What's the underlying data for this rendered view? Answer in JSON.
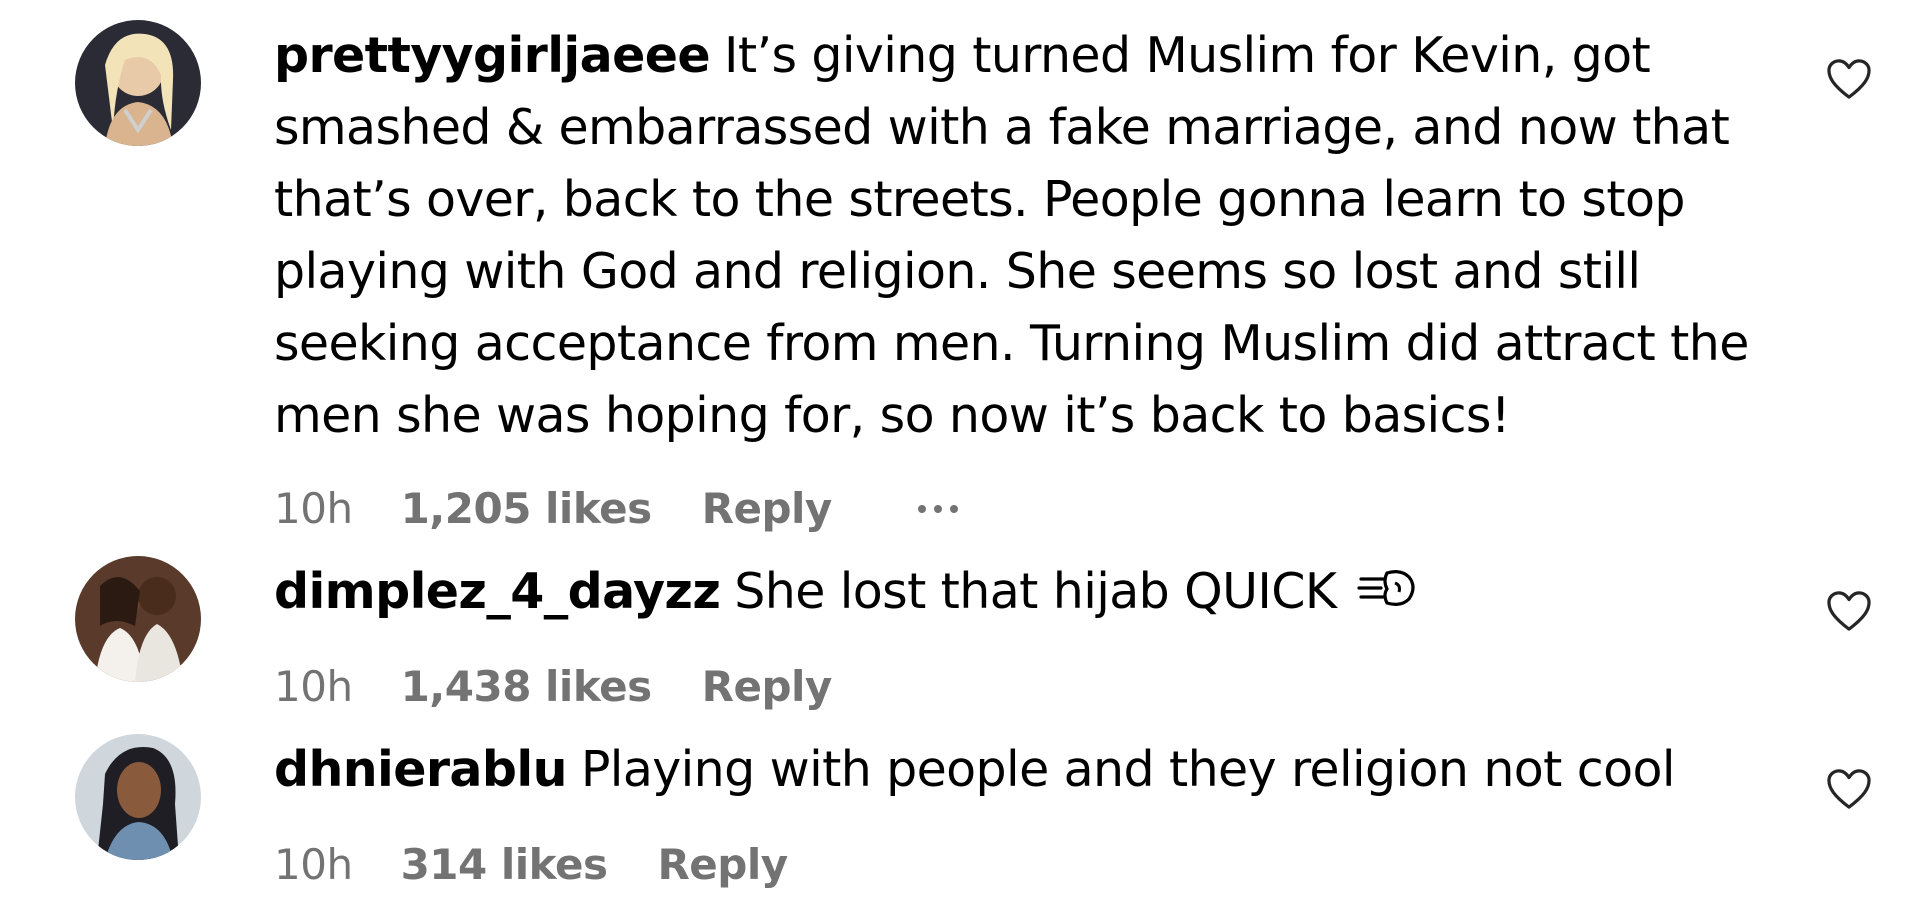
{
  "comments": [
    {
      "username": "prettyygirljaeee",
      "text": "It’s giving turned Muslim for Kevin, got smashed & embarrassed with a fake marriage, and now that that’s over, back to the streets. People gonna learn to stop playing with God and religion. She seems so lost and still seeking acceptance from men. Turning Muslim did attract the men she was hoping for, so now it’s back to basics!",
      "time": "10h",
      "likes": "1,205 likes",
      "reply_label": "Reply",
      "avatar_icon": "user-avatar-blonde",
      "heart_icon": "heart-outline-icon"
    },
    {
      "username": "dimplez_4_dayzz",
      "text": "She lost that hijab QUICK",
      "emoji": "💨",
      "time": "10h",
      "likes": "1,438 likes",
      "reply_label": "Reply",
      "avatar_icon": "user-avatar-couple",
      "heart_icon": "heart-outline-icon"
    },
    {
      "username": "dhnierablu",
      "text": "Playing with people and they religion not cool",
      "time": "10h",
      "likes": "314 likes",
      "reply_label": "Reply",
      "avatar_icon": "user-avatar-dark-hair",
      "heart_icon": "heart-outline-icon"
    }
  ],
  "colors": {
    "text": "#000000",
    "meta": "#737373",
    "background": "#ffffff"
  }
}
